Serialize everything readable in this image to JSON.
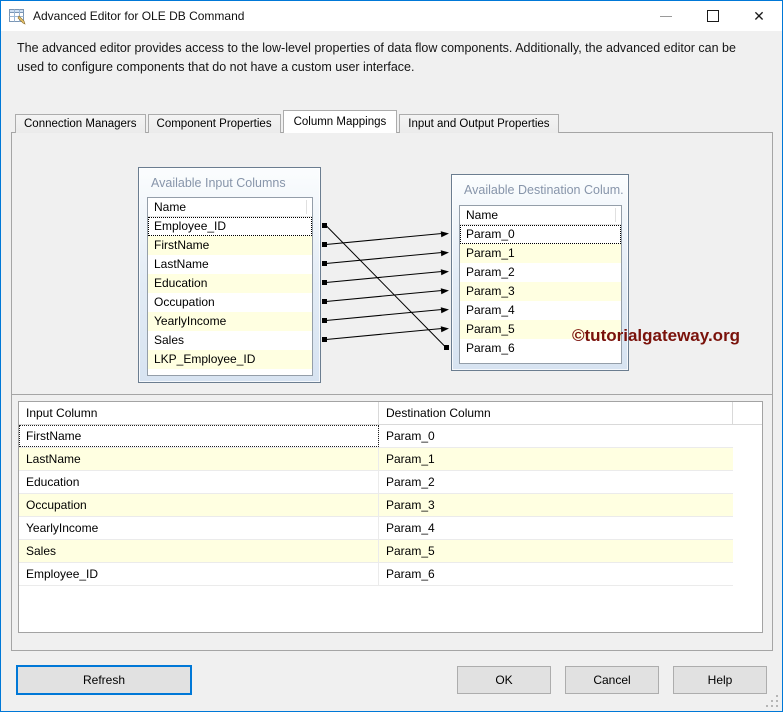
{
  "window": {
    "title": "Advanced Editor for OLE DB Command",
    "icon": "table-edit-icon",
    "controls": {
      "minimize": "minimize-icon",
      "maximize": "maximize-icon",
      "close": "✕"
    },
    "description": "The advanced editor provides access to the low-level properties of data flow components. Additionally, the advanced editor can be used to configure components that do not have a custom user interface."
  },
  "tabs": [
    {
      "label": "Connection Managers",
      "active": false
    },
    {
      "label": "Component Properties",
      "active": false
    },
    {
      "label": "Column Mappings",
      "active": true
    },
    {
      "label": "Input and Output Properties",
      "active": false
    }
  ],
  "input_columns_box": {
    "title": "Available Input Columns",
    "header": "Name",
    "rows": [
      "Employee_ID",
      "FirstName",
      "LastName",
      "Education",
      "Occupation",
      "YearlyIncome",
      "Sales",
      "LKP_Employee_ID"
    ],
    "focused_row": "Employee_ID"
  },
  "destination_columns_box": {
    "title": "Available Destination Colum...",
    "header": "Name",
    "rows": [
      "Param_0",
      "Param_1",
      "Param_2",
      "Param_3",
      "Param_4",
      "Param_5",
      "Param_6"
    ],
    "focused_row": "Param_0"
  },
  "mappings": [
    {
      "input": "Employee_ID",
      "destination": "Param_6",
      "selected": true
    },
    {
      "input": "FirstName",
      "destination": "Param_0",
      "selected": false
    },
    {
      "input": "LastName",
      "destination": "Param_1",
      "selected": false
    },
    {
      "input": "Education",
      "destination": "Param_2",
      "selected": false
    },
    {
      "input": "Occupation",
      "destination": "Param_3",
      "selected": false
    },
    {
      "input": "YearlyIncome",
      "destination": "Param_4",
      "selected": false
    },
    {
      "input": "Sales",
      "destination": "Param_5",
      "selected": false
    }
  ],
  "watermark": "©tutorialgateway.org",
  "mapping_table": {
    "columns": {
      "input": "Input Column",
      "destination": "Destination Column"
    },
    "rows": [
      {
        "input": "FirstName",
        "destination": "Param_0"
      },
      {
        "input": "LastName",
        "destination": "Param_1"
      },
      {
        "input": "Education",
        "destination": "Param_2"
      },
      {
        "input": "Occupation",
        "destination": "Param_3"
      },
      {
        "input": "YearlyIncome",
        "destination": "Param_4"
      },
      {
        "input": "Sales",
        "destination": "Param_5"
      },
      {
        "input": "Employee_ID",
        "destination": "Param_6"
      }
    ],
    "focused_cell": "FirstName"
  },
  "buttons": {
    "refresh": "Refresh",
    "ok": "OK",
    "cancel": "Cancel",
    "help": "Help"
  },
  "colors": {
    "accent": "#0078d7",
    "row_alt": "#ffffe1",
    "watermark": "#7a120b",
    "box_border": "#6b7d90"
  }
}
